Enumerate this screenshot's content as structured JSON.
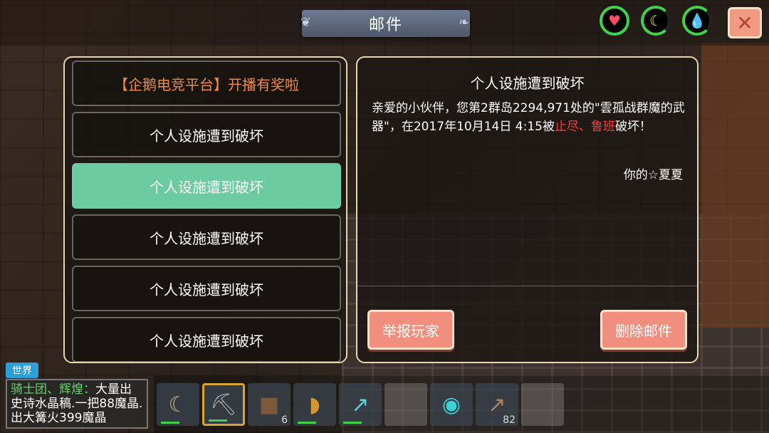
{
  "header": {
    "title": "邮件",
    "close_label": "✕"
  },
  "stats": {
    "heart_icon": "heart-icon",
    "food_icon": "banana-icon",
    "water_icon": "water-drop-icon"
  },
  "mail_list": [
    {
      "label": "【企鹅电竞平台】开播有奖啦",
      "type": "promo"
    },
    {
      "label": "个人设施遭到破坏",
      "type": "normal"
    },
    {
      "label": "个人设施遭到破坏",
      "type": "selected"
    },
    {
      "label": "个人设施遭到破坏",
      "type": "normal"
    },
    {
      "label": "个人设施遭到破坏",
      "type": "normal"
    },
    {
      "label": "个人设施遭到破坏",
      "type": "normal"
    }
  ],
  "mail_detail": {
    "title": "个人设施遭到破坏",
    "body_part1": "亲爱的小伙伴，您第2群岛2294,971处的\"雲孤战群魔的武器\"，在2017年10月14日 4:15被",
    "body_highlight": "止尽、鲁班",
    "body_part2": "破坏！",
    "signature": "你的☆夏夏",
    "report_label": "举报玩家",
    "delete_label": "删除邮件"
  },
  "chat": {
    "channel": "世界",
    "sender": "骑士团、辉煌：",
    "message": "大量出史诗水晶稿.一把88魔晶.出大篝火399魔晶"
  },
  "hotbar": [
    {
      "icon": "scythe-icon",
      "count": ""
    },
    {
      "icon": "pickaxe-icon",
      "count": ""
    },
    {
      "icon": "grass-block-icon",
      "count": "6"
    },
    {
      "icon": "banana-icon",
      "count": ""
    },
    {
      "icon": "spear-icon",
      "count": ""
    },
    {
      "icon": "empty-slot",
      "count": ""
    },
    {
      "icon": "orb-icon",
      "count": ""
    },
    {
      "icon": "arrow-icon",
      "count": "82"
    },
    {
      "icon": "empty-slot",
      "count": ""
    }
  ],
  "colors": {
    "accent_green": "#6ccba0",
    "button_red": "#f18e7e",
    "promo_orange": "#f08a3a",
    "highlight_red": "#ff3a3a",
    "chat_green": "#61d56a"
  }
}
